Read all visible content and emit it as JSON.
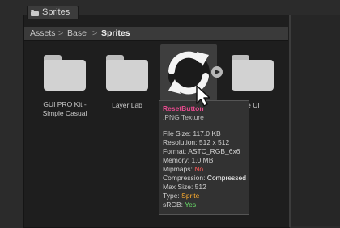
{
  "window": {
    "tab_label": "Sprites"
  },
  "breadcrumb": {
    "items": [
      "Assets",
      "Base",
      "Sprites"
    ],
    "separator": ">"
  },
  "assets": [
    {
      "label": "GUI PRO Kit -\nSimple Casual",
      "kind": "folder"
    },
    {
      "label": "Layer Lab",
      "kind": "folder"
    },
    {
      "label": "ResetButton",
      "kind": "sprite",
      "selected": true
    },
    {
      "label": "le UI",
      "kind": "folder"
    }
  ],
  "tooltip": {
    "name": "ResetButton",
    "type": ".PNG Texture",
    "file_size_label": "File Size:",
    "file_size": "117.0 KB",
    "resolution_label": "Resolution:",
    "resolution": "512 x 512",
    "format_label": "Format:",
    "format": "ASTC_RGB_6x6",
    "memory_label": "Memory:",
    "memory": "1.0 MB",
    "mipmaps_label": "Mipmaps:",
    "mipmaps": "No",
    "compression_label": "Compression:",
    "compression": "Compressed",
    "max_size_label": "Max Size:",
    "max_size": "512",
    "type_label": "Type:",
    "texture_type": "Sprite",
    "srgb_label": "sRGB:",
    "srgb": "Yes"
  },
  "colors": {
    "name": "#e94b8f",
    "no": "#ff5858",
    "sprite": "#ffad2e",
    "yes": "#6be36b"
  },
  "icons": {
    "folder": "folder-icon",
    "reset": "refresh-icon",
    "cursor": "cursor-arrow-icon",
    "play": "play-icon"
  }
}
